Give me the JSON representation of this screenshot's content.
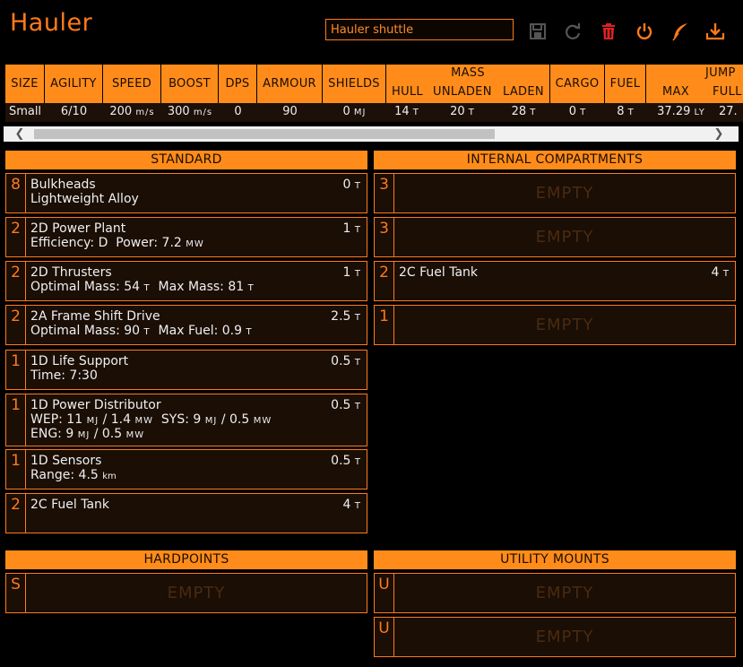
{
  "app": {
    "title": "Hauler"
  },
  "build_name": {
    "value": "Hauler shuttle"
  },
  "toolbar": {
    "icons": [
      "save-icon",
      "reload-icon",
      "trash-icon",
      "power-icon",
      "feather-icon",
      "export-icon"
    ],
    "accent": "#ff7a1a",
    "danger": "#e02020"
  },
  "stats": {
    "headers": {
      "size": "SIZE",
      "agility": "AGILITY",
      "speed": "SPEED",
      "boost": "BOOST",
      "dps": "DPS",
      "armour": "ARMOUR",
      "shields": "SHIELDS",
      "mass": "MASS",
      "hull": "HULL",
      "unladen": "UNLADEN",
      "laden": "LADEN",
      "cargo": "CARGO",
      "fuel": "FUEL",
      "jump": "JUMP",
      "max": "MAX",
      "full": "FULL"
    },
    "values": {
      "size": "Small",
      "agility": "6/10",
      "speed": "200",
      "speed_unit": "m/s",
      "boost": "300",
      "boost_unit": "m/s",
      "dps": "0",
      "armour": "90",
      "shields": "0",
      "shields_unit": "MJ",
      "hull": "14",
      "hull_unit": "T",
      "unladen": "20",
      "unladen_unit": "T",
      "laden": "28",
      "laden_unit": "T",
      "cargo": "0",
      "cargo_unit": "T",
      "fuel": "8",
      "fuel_unit": "T",
      "max": "37.29",
      "max_unit": "LY",
      "full": "27."
    }
  },
  "sections": {
    "standard": "STANDARD",
    "internal": "INTERNAL COMPARTMENTS",
    "hardpoints": "HARDPOINTS",
    "utility": "UTILITY MOUNTS"
  },
  "standard_slots": [
    {
      "cls": "8",
      "name": "Bulkheads",
      "mass": "0",
      "mass_unit": "T",
      "line1": "Lightweight Alloy"
    },
    {
      "cls": "2",
      "name": "2D Power Plant",
      "mass": "1",
      "mass_unit": "T",
      "l1a": "Efficiency: D",
      "l1b": "Power: 7.2",
      "l1b_unit": "MW"
    },
    {
      "cls": "2",
      "name": "2D Thrusters",
      "mass": "1",
      "mass_unit": "T",
      "l1a": "Optimal Mass: 54",
      "l1a_unit": "T",
      "l1b": "Max Mass: 81",
      "l1b_unit": "T"
    },
    {
      "cls": "2",
      "name": "2A Frame Shift Drive",
      "mass": "2.5",
      "mass_unit": "T",
      "l1a": "Optimal Mass: 90",
      "l1a_unit": "T",
      "l1b": "Max Fuel: 0.9",
      "l1b_unit": "T"
    },
    {
      "cls": "1",
      "name": "1D Life Support",
      "mass": "0.5",
      "mass_unit": "T",
      "line1": "Time: 7:30"
    },
    {
      "cls": "1",
      "name": "1D Power Distributor",
      "mass": "0.5",
      "mass_unit": "T",
      "wep": "WEP: 11",
      "wep_u1": "MJ",
      "wep_mid": "/ 1.4",
      "wep_u2": "MW",
      "sys": "SYS: 9",
      "sys_u1": "MJ",
      "sys_mid": "/ 0.5",
      "sys_u2": "MW",
      "eng": "ENG: 9",
      "eng_u1": "MJ",
      "eng_mid": "/ 0.5",
      "eng_u2": "MW"
    },
    {
      "cls": "1",
      "name": "1D Sensors",
      "mass": "0.5",
      "mass_unit": "T",
      "line1": "Range: 4.5",
      "line1_unit": "km"
    },
    {
      "cls": "2",
      "name": "2C Fuel Tank",
      "mass": "4",
      "mass_unit": "T"
    }
  ],
  "internal_slots": [
    {
      "cls": "3",
      "empty": "EMPTY"
    },
    {
      "cls": "3",
      "empty": "EMPTY"
    },
    {
      "cls": "2",
      "name": "2C Fuel Tank",
      "mass": "4",
      "mass_unit": "T"
    },
    {
      "cls": "1",
      "empty": "EMPTY"
    }
  ],
  "hardpoint_slots": [
    {
      "cls": "S",
      "empty": "EMPTY"
    }
  ],
  "utility_slots": [
    {
      "cls": "U",
      "empty": "EMPTY"
    },
    {
      "cls": "U",
      "empty": "EMPTY"
    }
  ]
}
